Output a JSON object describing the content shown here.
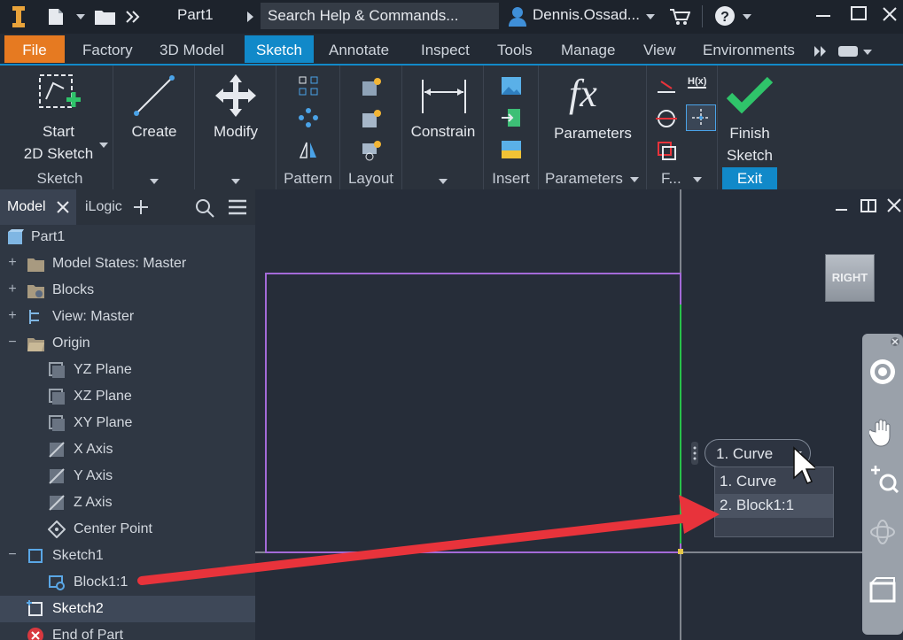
{
  "titlebar": {
    "doc_name": "Part1",
    "search_placeholder": "Search Help & Commands...",
    "user": "Dennis.Ossad...",
    "help_icon": "help-icon"
  },
  "menu": {
    "tabs": [
      "File",
      "Factory",
      "3D Model",
      "Sketch",
      "Annotate",
      "Inspect",
      "Tools",
      "Manage",
      "View",
      "Environments"
    ],
    "active": "Sketch"
  },
  "ribbon": {
    "sketch_panel": {
      "start_line1": "Start",
      "start_line2": "2D Sketch",
      "footer": "Sketch"
    },
    "create_panel": {
      "label": "Create"
    },
    "modify_panel": {
      "label": "Modify"
    },
    "pattern_panel": {
      "footer": "Pattern"
    },
    "layout_panel": {
      "footer": "Layout"
    },
    "constrain_panel": {
      "label": "Constrain"
    },
    "insert_panel": {
      "footer": "Insert"
    },
    "parameters_panel": {
      "label": "Parameters",
      "footer": "Parameters",
      "fx_symbol": "fx"
    },
    "format_panel": {
      "footer": "F...",
      "dim_icon_text": "H(x)"
    },
    "exit_panel": {
      "line1": "Finish",
      "line2": "Sketch",
      "footer": "Exit",
      "accent": "#2fc46a"
    }
  },
  "browser": {
    "tab_model": "Model",
    "tab_ilogic": "iLogic",
    "items": [
      {
        "label": "Part1"
      },
      {
        "label": "Model States: Master"
      },
      {
        "label": "Blocks"
      },
      {
        "label": "View: Master"
      },
      {
        "label": "Origin"
      },
      {
        "label": "YZ Plane"
      },
      {
        "label": "XZ Plane"
      },
      {
        "label": "XY Plane"
      },
      {
        "label": "X Axis"
      },
      {
        "label": "Y Axis"
      },
      {
        "label": "Z Axis"
      },
      {
        "label": "Center Point"
      },
      {
        "label": "Sketch1"
      },
      {
        "label": "Block1:1"
      },
      {
        "label": "Sketch2"
      },
      {
        "label": "End of Part"
      }
    ]
  },
  "canvas": {
    "viewcube_label": "RIGHT",
    "select_other": {
      "current": "1. Curve",
      "options": [
        "1. Curve",
        "2. Block1:1"
      ]
    }
  },
  "colors": {
    "accent": "#1189c9",
    "file_tab": "#e67a21",
    "sketch_rect": "#a46ad8",
    "green_line": "#28c24a",
    "arrow": "#e8333b"
  }
}
